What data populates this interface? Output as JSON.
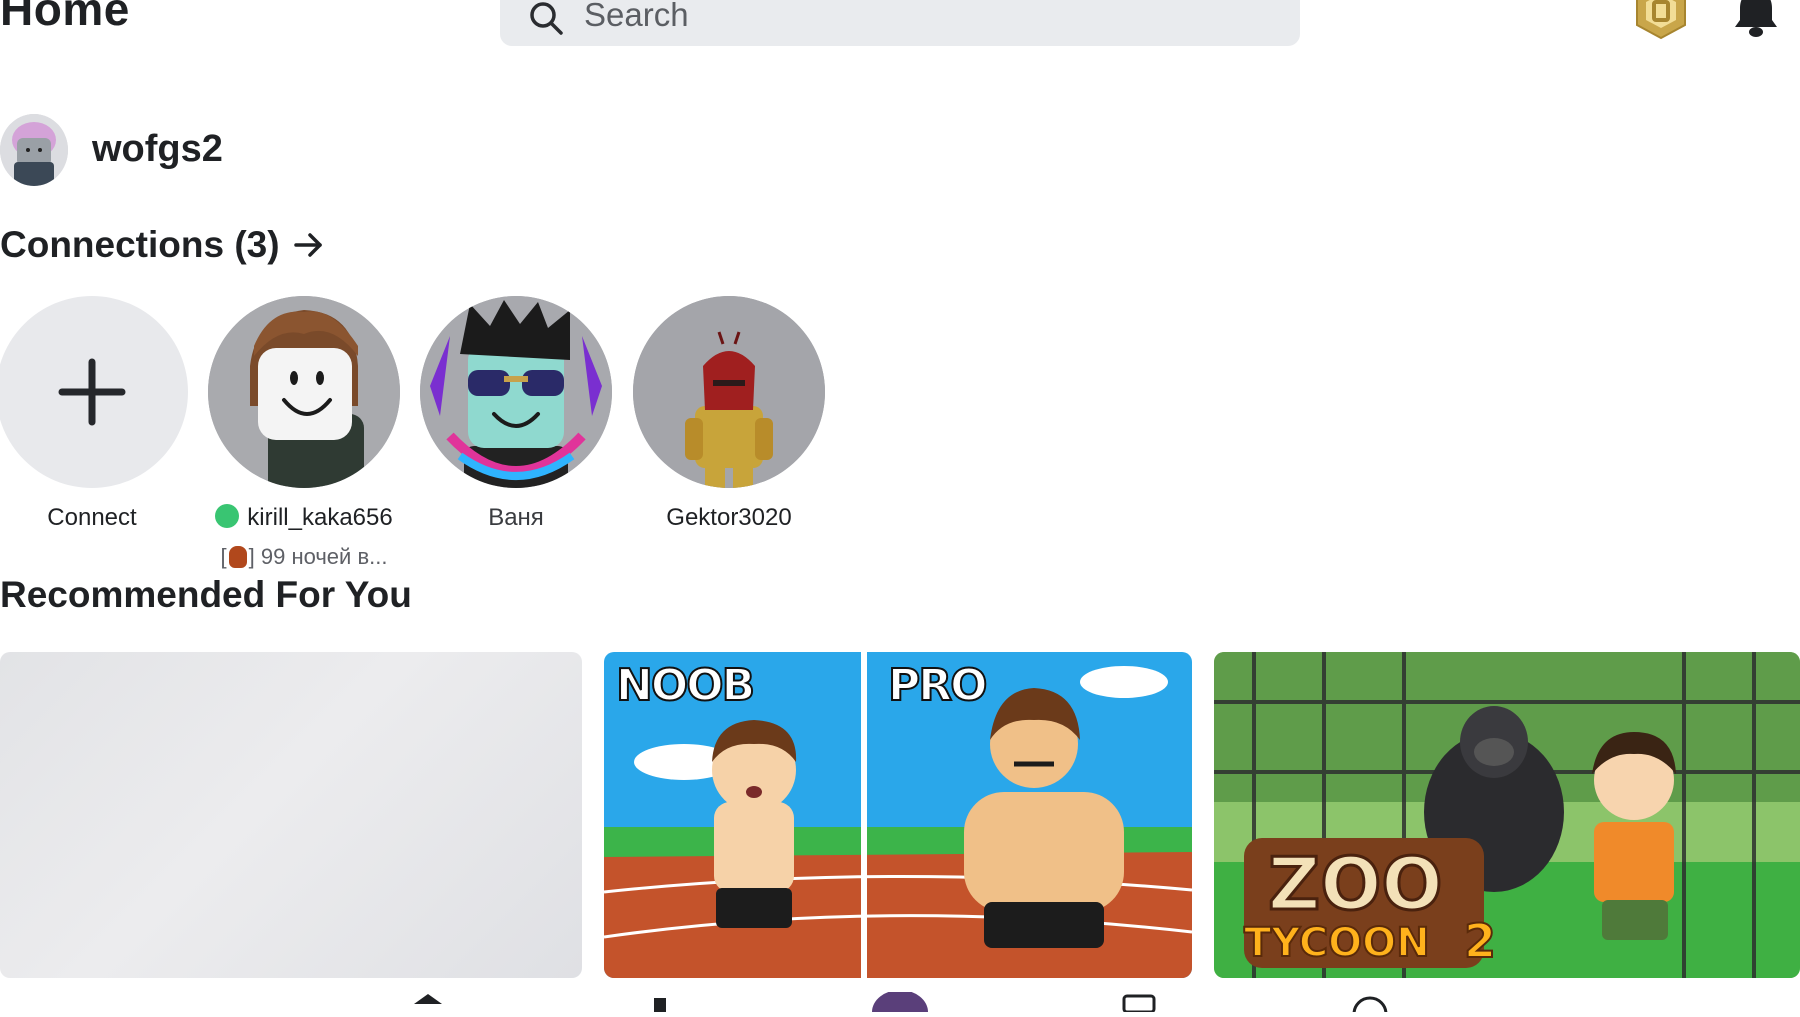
{
  "header": {
    "title": "Home",
    "search_placeholder": "Search"
  },
  "profile": {
    "username": "wofgs2"
  },
  "connections": {
    "heading": "Connections (3)",
    "items": [
      {
        "name": "Connect",
        "type": "add"
      },
      {
        "name": "kirill_kaka656",
        "online": true,
        "status": "] 99 ночей в...",
        "status_prefix": "["
      },
      {
        "name": "Ваня",
        "online": false
      },
      {
        "name": "Gektor3020",
        "online": false
      }
    ]
  },
  "recommended": {
    "heading": "Recommended For You",
    "tiles": [
      {
        "name": "loading-placeholder"
      },
      {
        "name": "noob-vs-pro",
        "labels": [
          "NOOB",
          "PRO"
        ]
      },
      {
        "name": "zoo-tycoon-2",
        "labels": [
          "ZOO",
          "TYCOON",
          "2"
        ]
      }
    ]
  },
  "colors": {
    "online": "#39c572",
    "search_bg": "#e9ebee",
    "robux_gold": "#c9a64a"
  }
}
